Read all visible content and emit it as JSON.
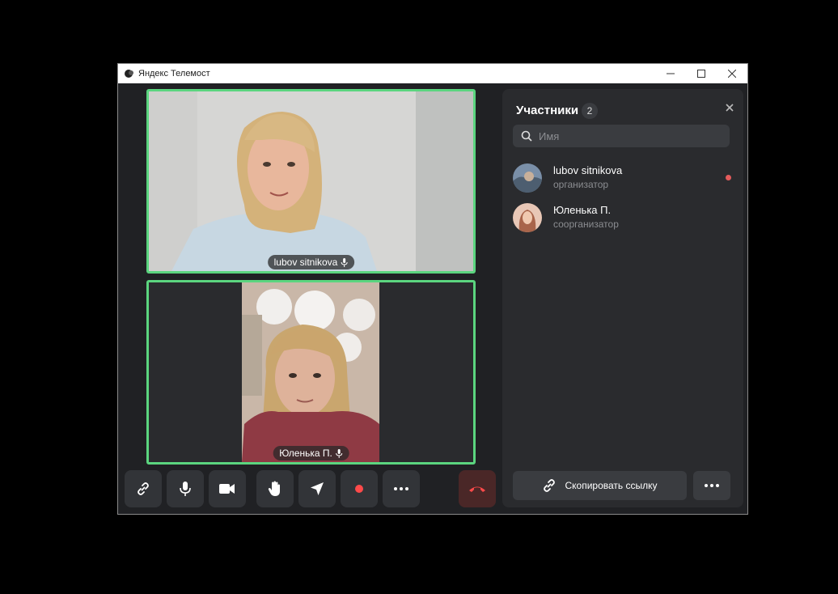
{
  "window": {
    "title": "Яндекс Телемост"
  },
  "tiles": [
    {
      "name": "lubov sitnikova"
    },
    {
      "name": "Юленька П."
    }
  ],
  "toolbar": {
    "buttons": [
      "link-icon",
      "microphone-icon",
      "camera-icon",
      "raise-hand-icon",
      "share-icon",
      "record-icon",
      "more-icon",
      "hang-up-icon"
    ]
  },
  "panel": {
    "title": "Участники",
    "count": "2",
    "search_placeholder": "Имя",
    "participants": [
      {
        "name": "lubov sitnikova",
        "role": "организатор"
      },
      {
        "name": "Юленька П.",
        "role": "соорганизатор"
      }
    ],
    "copy_link_label": "Скопировать ссылку"
  },
  "colors": {
    "active_speaker_border": "#5bd57f",
    "recording_dot": "#e45b5b",
    "hangup": "#ff4a4a"
  }
}
